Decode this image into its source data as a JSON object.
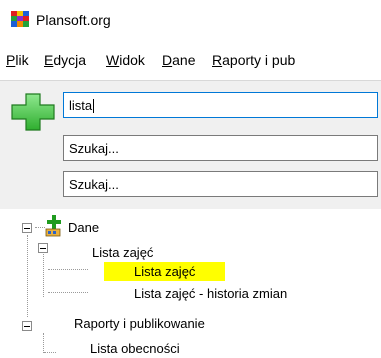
{
  "window": {
    "title": "Plansoft.org"
  },
  "menu": [
    {
      "label": "Plik",
      "underline": "P",
      "rest": "lik"
    },
    {
      "label": "Edycja",
      "underline": "E",
      "rest": "dycja"
    },
    {
      "label": "Widok",
      "underline": "W",
      "rest": "idok"
    },
    {
      "label": "Dane",
      "underline": "D",
      "rest": "ane"
    },
    {
      "label": "Raporty i publikowanie",
      "underline": "R",
      "rest": "aporty i pub"
    }
  ],
  "search": {
    "field1": "lista",
    "field2": "Szukaj...",
    "field3": "Szukaj..."
  },
  "tree": {
    "root": "Dane",
    "lista_group": "Lista zajęć",
    "lista_selected": "Lista zajęć",
    "historia": "Lista zajęć - historia zmian",
    "raporty": "Raporty i publikowanie",
    "obecnosci": "Lista obecności"
  },
  "colors": {
    "highlight": "#ffff00",
    "add_button": "#4cc44c"
  }
}
